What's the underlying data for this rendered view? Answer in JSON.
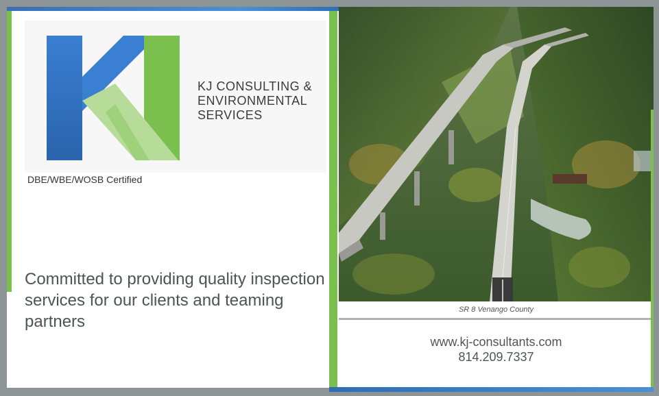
{
  "company": {
    "name_lines": [
      "KJ CONSULTING &",
      "ENVIRONMENTAL",
      "SERVICES"
    ],
    "logo_letters": "KJ",
    "certification": "DBE/WBE/WOSB Certified",
    "tagline": "Committed to providing quality inspection services for our clients and teaming partners"
  },
  "photo": {
    "caption": "SR 8 Venango County",
    "subject": "aerial photo of twin highway bridges over a forested valley"
  },
  "contact": {
    "website": "www.kj-consultants.com",
    "phone": "814.209.7337"
  },
  "colors": {
    "brand_blue": "#2f6db5",
    "brand_green": "#7bbf4e",
    "frame_gray": "#8d9496"
  }
}
